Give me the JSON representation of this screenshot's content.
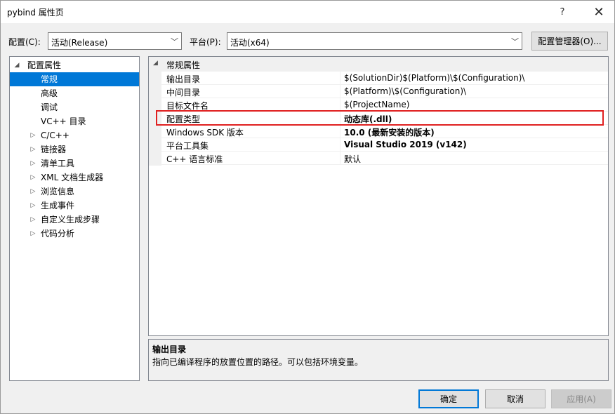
{
  "window": {
    "title": "pybind 属性页",
    "help_glyph": "?",
    "close_glyph": "✕"
  },
  "config_bar": {
    "config_label": "配置(C):",
    "config_value": "活动(Release)",
    "platform_label": "平台(P):",
    "platform_value": "活动(x64)",
    "manager_button": "配置管理器(O)..."
  },
  "tree": {
    "items": [
      {
        "label": "配置属性",
        "expander": "◢",
        "level": 0,
        "selected": false
      },
      {
        "label": "常规",
        "expander": "",
        "level": 1,
        "selected": true
      },
      {
        "label": "高级",
        "expander": "",
        "level": 1,
        "selected": false
      },
      {
        "label": "调试",
        "expander": "",
        "level": 1,
        "selected": false
      },
      {
        "label": "VC++ 目录",
        "expander": "",
        "level": 1,
        "selected": false
      },
      {
        "label": "C/C++",
        "expander": "▷",
        "level": 1,
        "selected": false
      },
      {
        "label": "链接器",
        "expander": "▷",
        "level": 1,
        "selected": false
      },
      {
        "label": "清单工具",
        "expander": "▷",
        "level": 1,
        "selected": false
      },
      {
        "label": "XML 文档生成器",
        "expander": "▷",
        "level": 1,
        "selected": false
      },
      {
        "label": "浏览信息",
        "expander": "▷",
        "level": 1,
        "selected": false
      },
      {
        "label": "生成事件",
        "expander": "▷",
        "level": 1,
        "selected": false
      },
      {
        "label": "自定义生成步骤",
        "expander": "▷",
        "level": 1,
        "selected": false
      },
      {
        "label": "代码分析",
        "expander": "▷",
        "level": 1,
        "selected": false
      }
    ]
  },
  "grid": {
    "category": "常规属性",
    "category_expander": "◢",
    "rows": [
      {
        "name": "输出目录",
        "value": "$(SolutionDir)$(Platform)\\$(Configuration)\\",
        "bold": false
      },
      {
        "name": "中间目录",
        "value": "$(Platform)\\$(Configuration)\\",
        "bold": false
      },
      {
        "name": "目标文件名",
        "value": "$(ProjectName)",
        "bold": false
      },
      {
        "name": "配置类型",
        "value": "动态库(.dll)",
        "bold": true
      },
      {
        "name": "Windows SDK 版本",
        "value": "10.0 (最新安装的版本)",
        "bold": true
      },
      {
        "name": "平台工具集",
        "value": "Visual Studio 2019 (v142)",
        "bold": true
      },
      {
        "name": "C++ 语言标准",
        "value": "默认",
        "bold": false
      }
    ],
    "highlight_color": "#e02020"
  },
  "description": {
    "title": "输出目录",
    "text": "指向已编译程序的放置位置的路径。可以包括环境变量。"
  },
  "buttons": {
    "ok": "确定",
    "cancel": "取消",
    "apply": "应用(A)"
  },
  "colors": {
    "selection": "#0078d7",
    "accent_border": "#0078d7"
  }
}
